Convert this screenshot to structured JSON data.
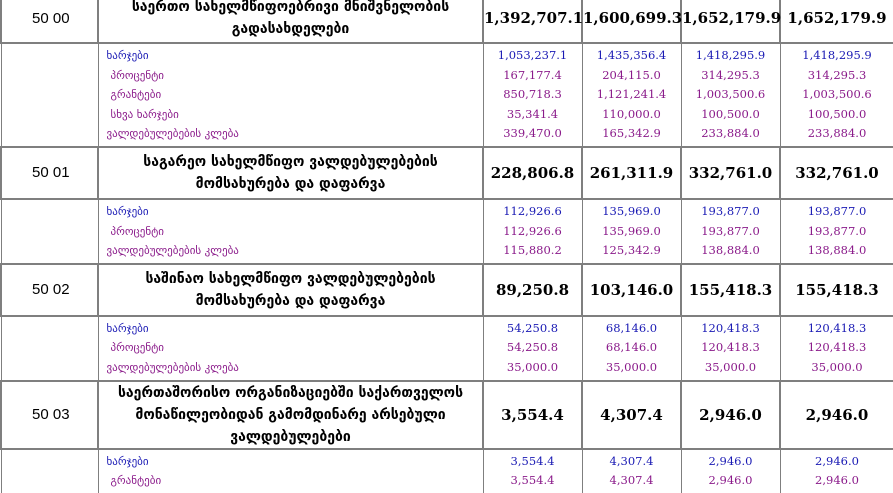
{
  "rows": [
    {
      "code": "50 00",
      "title_lines": [
        "საერთო სახელმწიფოებრივი მნიშვნელობის",
        "გადასახდელები"
      ],
      "values": [
        "1,392,707.1",
        "1,600,699.3",
        "1,652,179.9",
        "1,652,179.9"
      ],
      "sub": [
        {
          "label": "ხარჯები",
          "values": [
            "1,053,237.1",
            "1,435,356.4",
            "1,418,295.9",
            "1,418,295.9"
          ],
          "color": "blue",
          "indent": 1
        },
        {
          "label": "პროცენტი",
          "values": [
            "167,177.4",
            "204,115.0",
            "314,295.3",
            "314,295.3"
          ],
          "color": "purple",
          "indent": 2
        },
        {
          "label": "გრანტები",
          "values": [
            "850,718.3",
            "1,121,241.4",
            "1,003,500.6",
            "1,003,500.6"
          ],
          "color": "purple",
          "indent": 2
        },
        {
          "label": "სხვა ხარჯები",
          "values": [
            "35,341.4",
            "110,000.0",
            "100,500.0",
            "100,500.0"
          ],
          "color": "purple",
          "indent": 2
        },
        {
          "label": "ვალდებულებების კლება",
          "values": [
            "339,470.0",
            "165,342.9",
            "233,884.0",
            "233,884.0"
          ],
          "color": "purple",
          "indent": 1
        }
      ]
    },
    {
      "code": "50 01",
      "title_lines": [
        "საგარეო სახელმწიფო ვალდებულებების",
        "მომსახურება და დაფარვა"
      ],
      "values": [
        "228,806.8",
        "261,311.9",
        "332,761.0",
        "332,761.0"
      ],
      "sub": [
        {
          "label": "ხარჯები",
          "values": [
            "112,926.6",
            "135,969.0",
            "193,877.0",
            "193,877.0"
          ],
          "color": "blue",
          "indent": 1
        },
        {
          "label": "პროცენტი",
          "values": [
            "112,926.6",
            "135,969.0",
            "193,877.0",
            "193,877.0"
          ],
          "color": "purple",
          "indent": 2
        },
        {
          "label": "ვალდებულებების კლება",
          "values": [
            "115,880.2",
            "125,342.9",
            "138,884.0",
            "138,884.0"
          ],
          "color": "purple",
          "indent": 1
        }
      ]
    },
    {
      "code": "50 02",
      "title_lines": [
        "საშინაო სახელმწიფო ვალდებულებების",
        "მომსახურება და დაფარვა"
      ],
      "values": [
        "89,250.8",
        "103,146.0",
        "155,418.3",
        "155,418.3"
      ],
      "sub": [
        {
          "label": "ხარჯები",
          "values": [
            "54,250.8",
            "68,146.0",
            "120,418.3",
            "120,418.3"
          ],
          "color": "blue",
          "indent": 1
        },
        {
          "label": "პროცენტი",
          "values": [
            "54,250.8",
            "68,146.0",
            "120,418.3",
            "120,418.3"
          ],
          "color": "purple",
          "indent": 2
        },
        {
          "label": "ვალდებულებების კლება",
          "values": [
            "35,000.0",
            "35,000.0",
            "35,000.0",
            "35,000.0"
          ],
          "color": "purple",
          "indent": 1
        }
      ]
    },
    {
      "code": "50 03",
      "title_lines": [
        "საერთაშორისო ორგანიზაციებში საქართველოს",
        "მონაწილეობიდან გამომდინარე არსებული",
        "ვალდებულებები"
      ],
      "values": [
        "3,554.4",
        "4,307.4",
        "2,946.0",
        "2,946.0"
      ],
      "sub": [
        {
          "label": "ხარჯები",
          "values": [
            "3,554.4",
            "4,307.4",
            "2,946.0",
            "2,946.0"
          ],
          "color": "blue",
          "indent": 1
        },
        {
          "label": "გრანტები",
          "values": [
            "3,554.4",
            "4,307.4",
            "2,946.0",
            "2,946.0"
          ],
          "color": "purple",
          "indent": 2
        }
      ]
    }
  ]
}
